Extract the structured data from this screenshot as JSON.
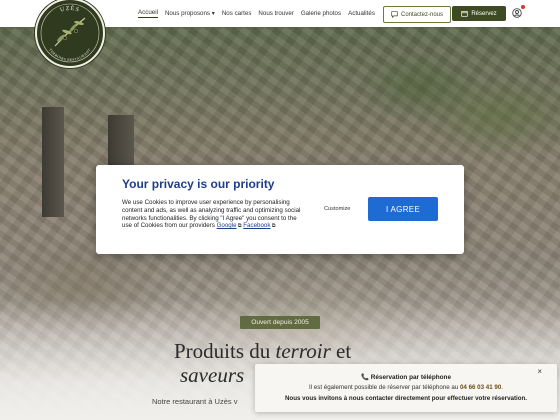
{
  "header": {
    "logo_text_top": "UZÈS",
    "logo_text_bottom": "TERROIRS RESTAURANT",
    "nav": [
      {
        "label": "Accueil",
        "active": true
      },
      {
        "label": "Nous proposons ▾",
        "active": false
      },
      {
        "label": "Nos cartes",
        "active": false
      },
      {
        "label": "Nous trouver",
        "active": false
      },
      {
        "label": "Galerie photos",
        "active": false
      },
      {
        "label": "Actualités",
        "active": false
      }
    ],
    "contact_label": "Contactez-nous",
    "reserve_label": "Réservez",
    "icons": {
      "contact": "chat-icon",
      "reserve": "calendar-icon",
      "account": "user-icon"
    }
  },
  "cookie": {
    "title": "Your privacy is our priority",
    "message": "We use Cookies to improve user experience by personalising content and ads, as well as analyzing traffic and optimizing social networks functionalities. By clicking \"I Agree\" you consent to the use of Cookies from our providers",
    "google_link": "Google",
    "facebook_link": "Facebook",
    "customize_label": "Customize",
    "agree_label": "I AGREE"
  },
  "hero": {
    "since": "Ouvert depuis 2005",
    "title_line1_a": "Produits du ",
    "title_line1_b": "terroir",
    "title_line1_c": " et",
    "title_line2": "saveurs",
    "subtitle": "Notre restaurant à Uzès v"
  },
  "toast": {
    "heading": "Réservation par téléphone",
    "line2_prefix": "Il est également possible de réserver par téléphone au ",
    "phone": "04 66 03 41 90",
    "line2_suffix": ".",
    "line3": "Nous vous invitons à nous contacter directement pour effectuer votre réservation.",
    "close": "×"
  },
  "colors": {
    "brand_green": "#3e4a22",
    "accent_blue": "#1f6bd4",
    "title_blue": "#1e3e8a"
  }
}
